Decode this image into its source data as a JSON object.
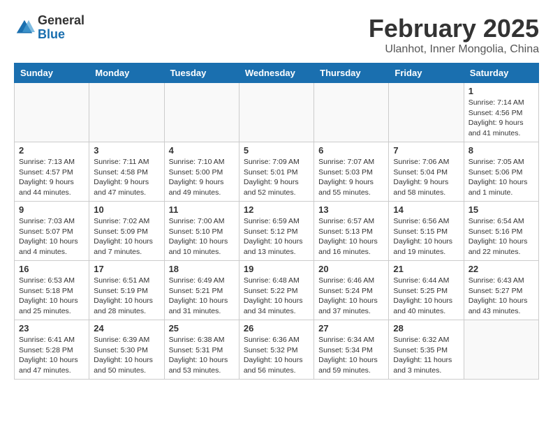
{
  "header": {
    "logo_general": "General",
    "logo_blue": "Blue",
    "month_year": "February 2025",
    "location": "Ulanhot, Inner Mongolia, China"
  },
  "days_of_week": [
    "Sunday",
    "Monday",
    "Tuesday",
    "Wednesday",
    "Thursday",
    "Friday",
    "Saturday"
  ],
  "weeks": [
    [
      {
        "day": "",
        "info": ""
      },
      {
        "day": "",
        "info": ""
      },
      {
        "day": "",
        "info": ""
      },
      {
        "day": "",
        "info": ""
      },
      {
        "day": "",
        "info": ""
      },
      {
        "day": "",
        "info": ""
      },
      {
        "day": "1",
        "info": "Sunrise: 7:14 AM\nSunset: 4:56 PM\nDaylight: 9 hours and 41 minutes."
      }
    ],
    [
      {
        "day": "2",
        "info": "Sunrise: 7:13 AM\nSunset: 4:57 PM\nDaylight: 9 hours and 44 minutes."
      },
      {
        "day": "3",
        "info": "Sunrise: 7:11 AM\nSunset: 4:58 PM\nDaylight: 9 hours and 47 minutes."
      },
      {
        "day": "4",
        "info": "Sunrise: 7:10 AM\nSunset: 5:00 PM\nDaylight: 9 hours and 49 minutes."
      },
      {
        "day": "5",
        "info": "Sunrise: 7:09 AM\nSunset: 5:01 PM\nDaylight: 9 hours and 52 minutes."
      },
      {
        "day": "6",
        "info": "Sunrise: 7:07 AM\nSunset: 5:03 PM\nDaylight: 9 hours and 55 minutes."
      },
      {
        "day": "7",
        "info": "Sunrise: 7:06 AM\nSunset: 5:04 PM\nDaylight: 9 hours and 58 minutes."
      },
      {
        "day": "8",
        "info": "Sunrise: 7:05 AM\nSunset: 5:06 PM\nDaylight: 10 hours and 1 minute."
      }
    ],
    [
      {
        "day": "9",
        "info": "Sunrise: 7:03 AM\nSunset: 5:07 PM\nDaylight: 10 hours and 4 minutes."
      },
      {
        "day": "10",
        "info": "Sunrise: 7:02 AM\nSunset: 5:09 PM\nDaylight: 10 hours and 7 minutes."
      },
      {
        "day": "11",
        "info": "Sunrise: 7:00 AM\nSunset: 5:10 PM\nDaylight: 10 hours and 10 minutes."
      },
      {
        "day": "12",
        "info": "Sunrise: 6:59 AM\nSunset: 5:12 PM\nDaylight: 10 hours and 13 minutes."
      },
      {
        "day": "13",
        "info": "Sunrise: 6:57 AM\nSunset: 5:13 PM\nDaylight: 10 hours and 16 minutes."
      },
      {
        "day": "14",
        "info": "Sunrise: 6:56 AM\nSunset: 5:15 PM\nDaylight: 10 hours and 19 minutes."
      },
      {
        "day": "15",
        "info": "Sunrise: 6:54 AM\nSunset: 5:16 PM\nDaylight: 10 hours and 22 minutes."
      }
    ],
    [
      {
        "day": "16",
        "info": "Sunrise: 6:53 AM\nSunset: 5:18 PM\nDaylight: 10 hours and 25 minutes."
      },
      {
        "day": "17",
        "info": "Sunrise: 6:51 AM\nSunset: 5:19 PM\nDaylight: 10 hours and 28 minutes."
      },
      {
        "day": "18",
        "info": "Sunrise: 6:49 AM\nSunset: 5:21 PM\nDaylight: 10 hours and 31 minutes."
      },
      {
        "day": "19",
        "info": "Sunrise: 6:48 AM\nSunset: 5:22 PM\nDaylight: 10 hours and 34 minutes."
      },
      {
        "day": "20",
        "info": "Sunrise: 6:46 AM\nSunset: 5:24 PM\nDaylight: 10 hours and 37 minutes."
      },
      {
        "day": "21",
        "info": "Sunrise: 6:44 AM\nSunset: 5:25 PM\nDaylight: 10 hours and 40 minutes."
      },
      {
        "day": "22",
        "info": "Sunrise: 6:43 AM\nSunset: 5:27 PM\nDaylight: 10 hours and 43 minutes."
      }
    ],
    [
      {
        "day": "23",
        "info": "Sunrise: 6:41 AM\nSunset: 5:28 PM\nDaylight: 10 hours and 47 minutes."
      },
      {
        "day": "24",
        "info": "Sunrise: 6:39 AM\nSunset: 5:30 PM\nDaylight: 10 hours and 50 minutes."
      },
      {
        "day": "25",
        "info": "Sunrise: 6:38 AM\nSunset: 5:31 PM\nDaylight: 10 hours and 53 minutes."
      },
      {
        "day": "26",
        "info": "Sunrise: 6:36 AM\nSunset: 5:32 PM\nDaylight: 10 hours and 56 minutes."
      },
      {
        "day": "27",
        "info": "Sunrise: 6:34 AM\nSunset: 5:34 PM\nDaylight: 10 hours and 59 minutes."
      },
      {
        "day": "28",
        "info": "Sunrise: 6:32 AM\nSunset: 5:35 PM\nDaylight: 11 hours and 3 minutes."
      },
      {
        "day": "",
        "info": ""
      }
    ]
  ]
}
